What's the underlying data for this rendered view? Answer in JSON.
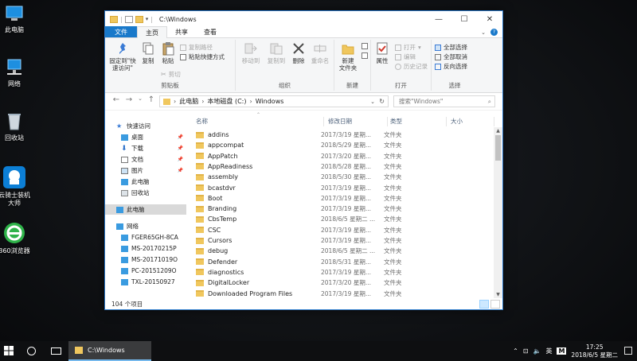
{
  "desktop": {
    "icons": [
      {
        "label": "此电脑"
      },
      {
        "label": "网络"
      },
      {
        "label": "回收站"
      },
      {
        "label": "云骑士装机大师"
      },
      {
        "label": "360浏览器"
      }
    ]
  },
  "window": {
    "title": "C:\\Windows",
    "tabs": [
      "文件",
      "主页",
      "共享",
      "查看"
    ],
    "ribbon": {
      "clipboard": {
        "name": "剪贴板",
        "pin": "固定到\"快速访问\"",
        "copy": "复制",
        "paste": "粘贴",
        "copy_path": "复制路径",
        "paste_shortcut": "粘贴快捷方式",
        "cut": "剪切"
      },
      "organize": {
        "name": "组织",
        "move_to": "移动到",
        "copy_to": "复制到",
        "delete": "删除",
        "rename": "重命名"
      },
      "new": {
        "name": "新建",
        "new_folder": "新建\n文件夹"
      },
      "open": {
        "name": "打开",
        "properties": "属性",
        "open": "打开",
        "edit": "编辑",
        "history": "历史记录"
      },
      "select": {
        "name": "选择",
        "select_all": "全部选择",
        "select_none": "全部取消",
        "invert": "反向选择"
      }
    },
    "address": {
      "path": [
        "此电脑",
        "本地磁盘 (C:)",
        "Windows"
      ],
      "search_placeholder": "搜索\"Windows\""
    },
    "nav": {
      "quick_access": "快速访问",
      "quick_items": [
        "桌面",
        "下载",
        "文档",
        "图片",
        "此电脑",
        "回收站"
      ],
      "this_pc": "此电脑",
      "network": "网络",
      "network_items": [
        "FGER65GH-8CA",
        "MS-20170215P",
        "MS-20171019O",
        "PC-20151209O",
        "TXL-20150927"
      ]
    },
    "columns": {
      "name": "名称",
      "date": "修改日期",
      "type": "类型",
      "size": "大小"
    },
    "files": [
      {
        "name": "addins",
        "date": "2017/3/19 星期...",
        "type": "文件夹"
      },
      {
        "name": "appcompat",
        "date": "2018/5/29 星期...",
        "type": "文件夹"
      },
      {
        "name": "AppPatch",
        "date": "2017/3/20 星期...",
        "type": "文件夹"
      },
      {
        "name": "AppReadiness",
        "date": "2018/5/28 星期...",
        "type": "文件夹"
      },
      {
        "name": "assembly",
        "date": "2018/5/30 星期...",
        "type": "文件夹"
      },
      {
        "name": "bcastdvr",
        "date": "2017/3/19 星期...",
        "type": "文件夹"
      },
      {
        "name": "Boot",
        "date": "2017/3/19 星期...",
        "type": "文件夹"
      },
      {
        "name": "Branding",
        "date": "2017/3/19 星期...",
        "type": "文件夹"
      },
      {
        "name": "CbsTemp",
        "date": "2018/6/5 星期二 ...",
        "type": "文件夹"
      },
      {
        "name": "CSC",
        "date": "2017/3/19 星期...",
        "type": "文件夹"
      },
      {
        "name": "Cursors",
        "date": "2017/3/19 星期...",
        "type": "文件夹"
      },
      {
        "name": "debug",
        "date": "2018/6/5 星期二 ...",
        "type": "文件夹"
      },
      {
        "name": "Defender",
        "date": "2018/5/31 星期...",
        "type": "文件夹"
      },
      {
        "name": "diagnostics",
        "date": "2017/3/19 星期...",
        "type": "文件夹"
      },
      {
        "name": "DigitalLocker",
        "date": "2017/3/20 星期...",
        "type": "文件夹"
      },
      {
        "name": "Downloaded Program Files",
        "date": "2017/3/19 星期...",
        "type": "文件夹"
      }
    ],
    "status": "104 个项目"
  },
  "taskbar": {
    "task_label": "C:\\Windows",
    "ime": "英",
    "ime2": "M",
    "time": "17:25",
    "date": "2018/6/5 星期二"
  },
  "colors": {
    "accent": "#1979ca",
    "folder": "#f0c75e"
  }
}
